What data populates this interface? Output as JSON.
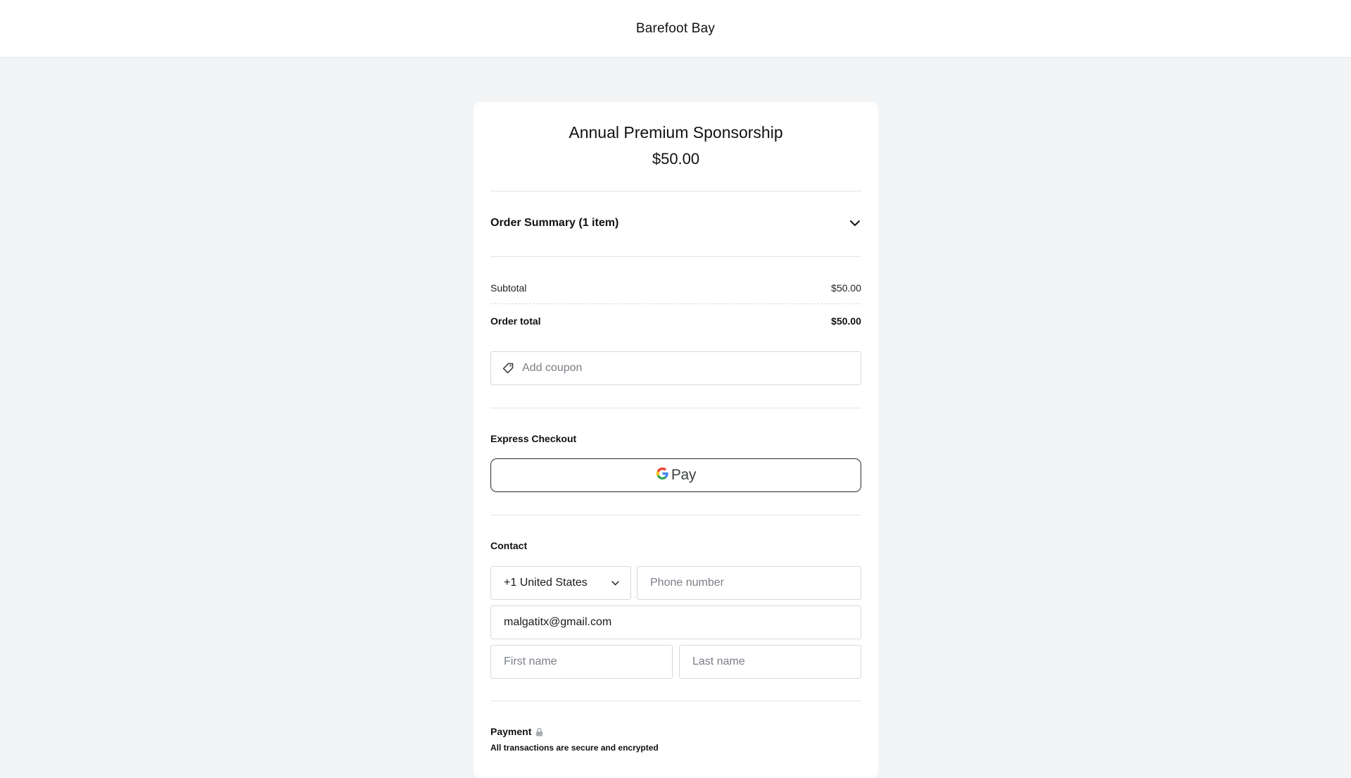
{
  "header": {
    "brand": "Barefoot Bay"
  },
  "product": {
    "title": "Annual Premium Sponsorship",
    "price": "$50.00"
  },
  "order_summary": {
    "label": "Order Summary (1 item)",
    "icon": "chevron-down-icon"
  },
  "totals": {
    "subtotal_label": "Subtotal",
    "subtotal_value": "$50.00",
    "total_label": "Order total",
    "total_value": "$50.00"
  },
  "coupon": {
    "placeholder": "Add coupon",
    "icon": "tag-icon"
  },
  "express": {
    "label": "Express Checkout",
    "gpay_word": "Pay"
  },
  "contact": {
    "label": "Contact",
    "country": "+1 United States",
    "phone_placeholder": "Phone number",
    "email": "malgatitx@gmail.com",
    "first_placeholder": "First name",
    "last_placeholder": "Last name"
  },
  "payment": {
    "label": "Payment",
    "note": "All transactions are secure and encrypted",
    "icon": "lock-icon"
  },
  "colors": {
    "accent": "#111111",
    "background": "#f3f4f6",
    "card": "#ffffff"
  }
}
